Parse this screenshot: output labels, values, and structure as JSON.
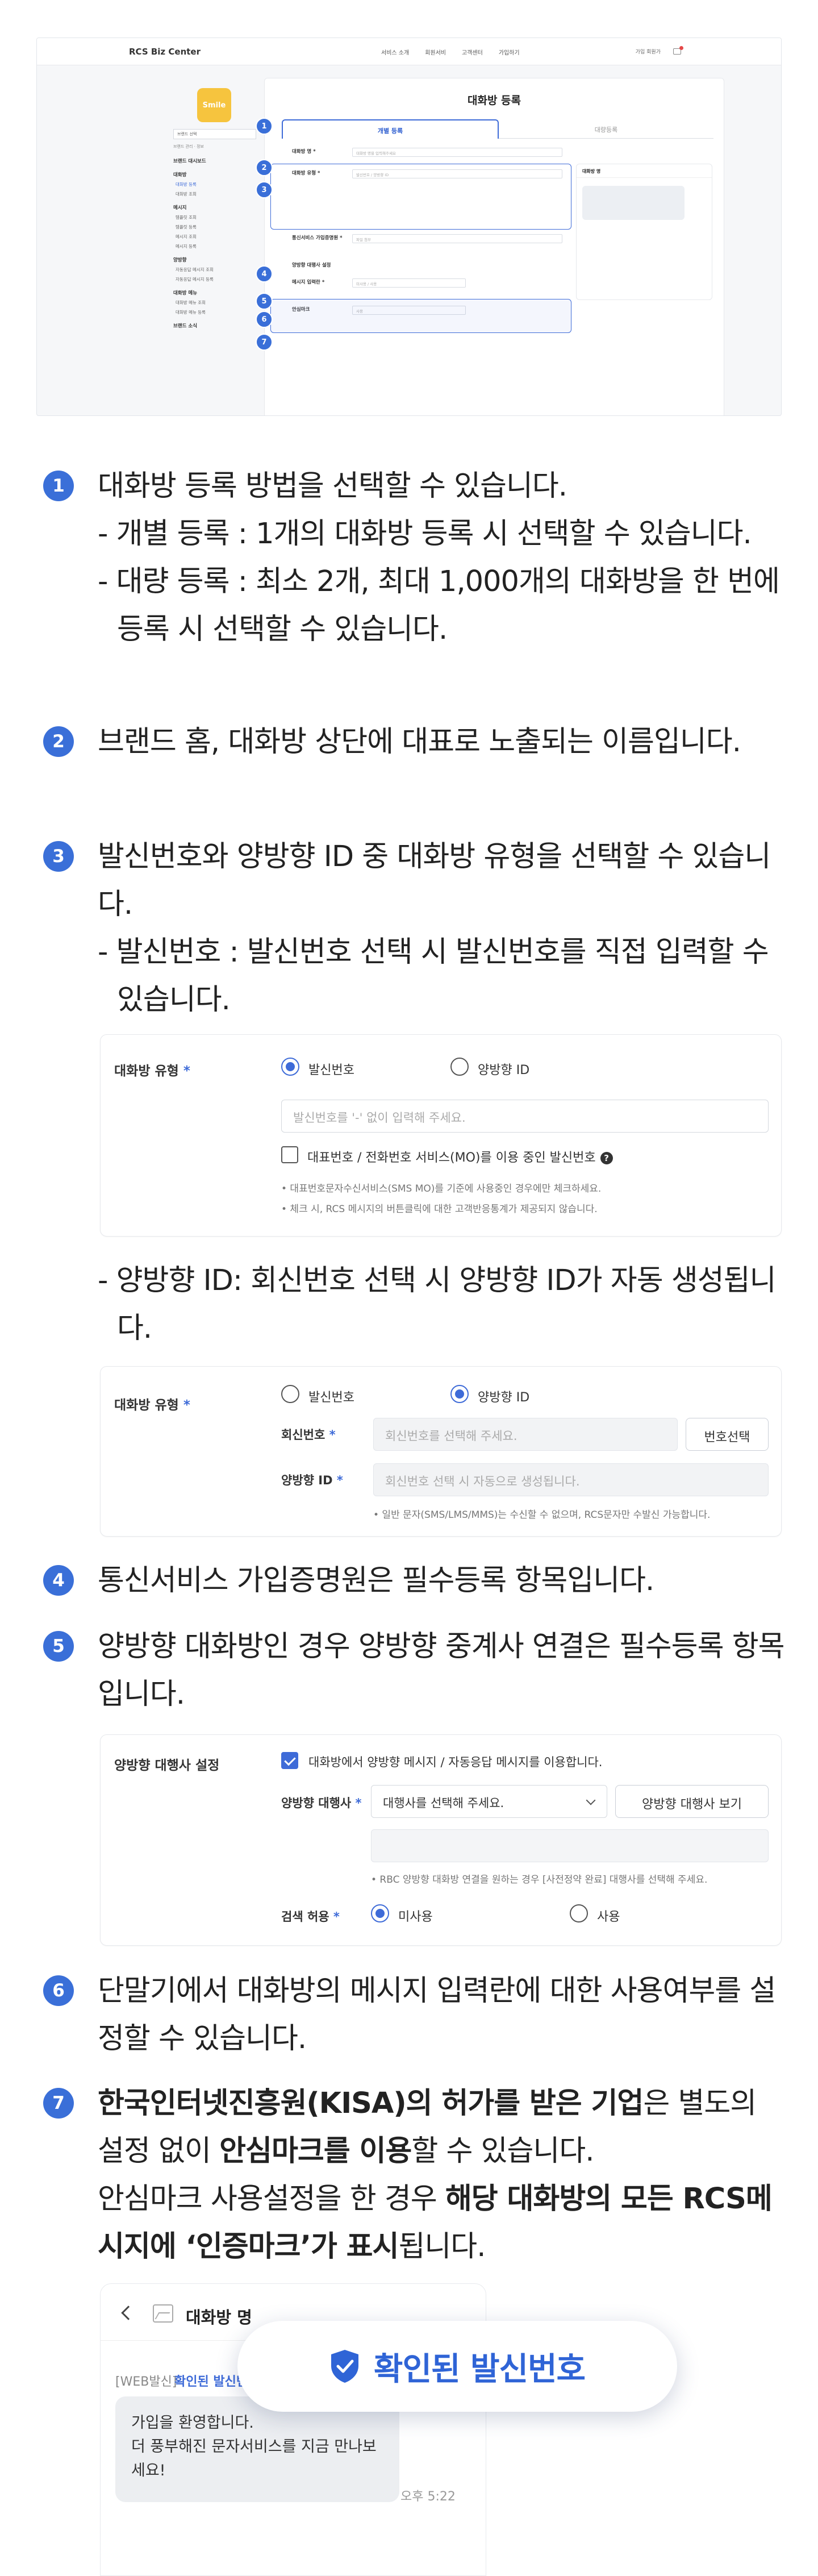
{
  "screenshot": {
    "logo": "RCS Biz Center",
    "nav": [
      "서비스 소개",
      "회원서비",
      "고객센터",
      "가입하기",
      "가입 회원가"
    ],
    "brand_badge": "Smile",
    "sidebar": {
      "select": "브랜드 선택",
      "meta": "브랜드 관리 · 정보",
      "groups": [
        {
          "title": "브랜드 대시보드",
          "items": []
        },
        {
          "title": "대화방",
          "items": [
            "대화방 등록",
            "대화방 조회"
          ]
        },
        {
          "title": "메시지",
          "items": [
            "템플릿 조회",
            "템플릿 등록",
            "메시지 조회",
            "메시지 등록"
          ]
        },
        {
          "title": "양방향",
          "items": [
            "자동응답 메시지 조회",
            "자동응답 메시지 등록"
          ]
        },
        {
          "title": "대화방 메뉴",
          "items": [
            "대화방 메뉴 조회",
            "대화방 메뉴 등록"
          ]
        },
        {
          "title": "브랜드 소식",
          "items": []
        }
      ]
    },
    "main_title": "대화방 등록",
    "tabs": [
      "개별 등록",
      "대량등록"
    ],
    "rows": [
      {
        "label": "대화방 명 *",
        "placeholder": "대화방 명을 입력해주세요"
      },
      {
        "label": "대화방 유형 *",
        "placeholder": "발신번호 / 양방향 ID"
      },
      {
        "label": "통신서비스 가입증명원 *",
        "placeholder": "파일 첨부"
      },
      {
        "label": "양방향 대행사 설정",
        "placeholder": ""
      },
      {
        "label": "메시지 입력란 *",
        "placeholder": "미사용 / 사용"
      },
      {
        "label": "안심마크",
        "placeholder": "사용"
      }
    ],
    "phone_title": "대화방 명"
  },
  "steps": {
    "s1": {
      "num": "1",
      "lines": [
        "대화방 등록 방법을 선택할 수 있습니다.",
        "- 개별 등록 : 1개의 대화방 등록 시 선택할 수 있습니다.",
        "- 대량 등록 : 최소 2개, 최대 1,000개의 대화방을 한 번에 등록 시 선택할 수 있습니다."
      ]
    },
    "s2": {
      "num": "2",
      "text": "브랜드 홈, 대화방 상단에 대표로 노출되는 이름입니다."
    },
    "s3": {
      "num": "3",
      "lines": [
        "발신번호와 양방향 ID 중 대화방 유형을 선택할 수 있습니다.",
        "- 발신번호 : 발신번호 선택 시 발신번호를 직접 입력할 수 있습니다."
      ],
      "sub2": "- 양방향 ID: 회신번호 선택 시 양방향 ID가 자동 생성됩니다."
    },
    "s4": {
      "num": "4",
      "text": "통신서비스 가입증명원은 필수등록 항목입니다."
    },
    "s5": {
      "num": "5",
      "text": "양방향 대화방인 경우 양방향 중계사 연결은 필수등록 항목입니다."
    },
    "s6": {
      "num": "6",
      "text": "단말기에서 대화방의 메시지 입력란에 대한 사용여부를 설정할 수 있습니다."
    },
    "s7": {
      "num": "7",
      "p1_b1": "한국인터넷진흥원(KISA)의 허가를 받은 기업",
      "p1_t1": "은 별도의 설정 없이 ",
      "p1_b2": "안심마크를 이용",
      "p1_t2": "할 수 있습니다.",
      "p2_t1": "안심마크 사용설정을 한 경우 ",
      "p2_b1": "해당 대화방의 모든 RCS메시지에 ‘인증마크’가 표시",
      "p2_t2": "됩니다."
    }
  },
  "card1": {
    "label": "대화방 유형",
    "req": "*",
    "opt1": "발신번호",
    "opt2": "양방향 ID",
    "placeholder": "발신번호를 '-' 없이 입력해 주세요.",
    "checkbox": "대표번호 / 전화번호 서비스(MO)를 이용 중인 발신번호",
    "notes": [
      "• 대표번호문자수신서비스(SMS MO)를 기준에 사용중인 경우에만 체크하세요.",
      "• 체크 시, RCS 메시지의 버튼클릭에 대한 고객반응통계가 제공되지 않습니다."
    ]
  },
  "card2": {
    "label": "대화방 유형",
    "req": "*",
    "opt1": "발신번호",
    "opt2": "양방향 ID",
    "reply_label": "회신번호",
    "reply_placeholder": "회신번호를 선택해 주세요.",
    "reply_button": "번호선택",
    "id_label": "양방향 ID",
    "id_placeholder": "회신번호 선택 시 자동으로 생성됩니다.",
    "note": "• 일반 문자(SMS/LMS/MMS)는 수신할 수 없으며, RCS문자만 수발신 가능합니다."
  },
  "card3": {
    "label": "양방향 대행사 설정",
    "checkbox": "대화방에서 양방향 메시지 / 자동응답 메시지를 이용합니다.",
    "agent_label": "양방향 대행사",
    "req": "*",
    "agent_select": "대행사를 선택해 주세요.",
    "agent_button": "양방향 대행사 보기",
    "note": "• RBC 양방향 대화방 연결을 원하는 경우 [사전정약 완료] 대행사를 선택해 주세요.",
    "search_label": "검색 허용",
    "search_opt1": "미사용",
    "search_opt2": "사용"
  },
  "chat": {
    "title": "대화방 명",
    "webtag": "[WEB발신]",
    "verified_small": "확인된 발신번호",
    "message": [
      "가입을 환영합니다.",
      "더 풍부해진 문자서비스를 지금 만나보",
      "세요!"
    ],
    "time": "오후 5:22",
    "badge": "확인된 발신번호"
  },
  "colors": {
    "accent": "#3a6fd8",
    "text": "#222222",
    "muted": "#777777"
  },
  "icons": [
    "check-shield-icon",
    "back-icon",
    "image-icon",
    "help-icon",
    "cart-icon",
    "chevron-down-icon"
  ]
}
